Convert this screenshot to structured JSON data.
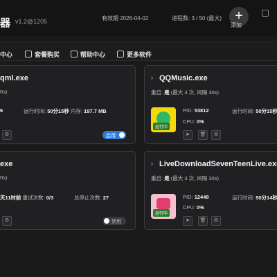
{
  "header": {
    "app_title": "器",
    "version": "v1.2@1205",
    "expiry_label": "有效期",
    "expiry_date": "2026-04-02",
    "process_label": "进程数:",
    "process_value": "3 / 50",
    "process_note": "(最大)",
    "add_label": "添加",
    "add_glyph": "+"
  },
  "nav": [
    {
      "label": "中心"
    },
    {
      "label": "套餐购买"
    },
    {
      "label": "帮助中心"
    },
    {
      "label": "更多软件"
    }
  ],
  "cards": {
    "card1": {
      "title": "qml.exe",
      "sub": "0s)",
      "pid_fragment": "6",
      "runtime_label": "运行时间:",
      "runtime": "50分15秒",
      "mem_label": "内存:",
      "mem": "197.7 MB",
      "toggle_label": "启用"
    },
    "card2": {
      "title": "QQMusic.exe",
      "restart_label": "重启:",
      "restart_value": "是",
      "restart_detail": "(最大 3 次, 间隔 30s)",
      "pid_label": "PID:",
      "pid": "53812",
      "runtime_label": "运行时间:",
      "runtime": "50分15秒",
      "cpu_label": "CPU:",
      "cpu": "0%",
      "badge": "运行中"
    },
    "card3": {
      "title": "exe",
      "sub": "0s)",
      "runtime_fragment": "天11时前",
      "retry_label": "重试次数:",
      "retry": "0/3",
      "stop_label": "总停止次数:",
      "stop": "27",
      "toggle_label": "禁用"
    },
    "card4": {
      "title": "LiveDownloadSevenTeenLive.exe",
      "restart_label": "重启:",
      "restart_value": "是",
      "restart_detail": "(最大 3 次, 间隔 30s)",
      "pid_label": "PID:",
      "pid": "12448",
      "runtime_label": "运行时间:",
      "runtime": "50分14秒",
      "cpu_label": "CPU:",
      "cpu": "0%",
      "badge": "运行中"
    }
  },
  "colors": {
    "accent": "#2f7bd9",
    "running": "#2c7a2c"
  },
  "icons": [
    "add-icon",
    "gear-icon",
    "send-icon",
    "trash-icon",
    "chevron-right-icon",
    "chevron-down-icon"
  ]
}
